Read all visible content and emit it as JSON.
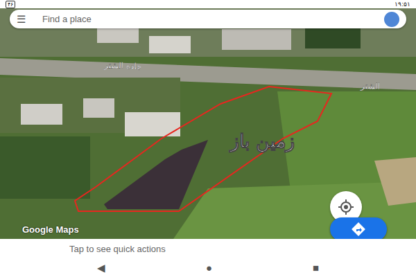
{
  "status_bar": {
    "time": "۱۹:۵۱",
    "battery": "۴۶"
  },
  "search": {
    "menu_icon": "☰",
    "placeholder": "Find a place"
  },
  "map": {
    "labels": [
      {
        "text": "جاده الشتر"
      },
      {
        "text": "الشتر"
      }
    ],
    "watermark": "زمین باز",
    "attribution": "Google Maps"
  },
  "bottom_sheet": {
    "hint": "Tap to see quick actions"
  },
  "nav_bar": {
    "buttons": [
      "◀",
      "●",
      "■"
    ]
  }
}
